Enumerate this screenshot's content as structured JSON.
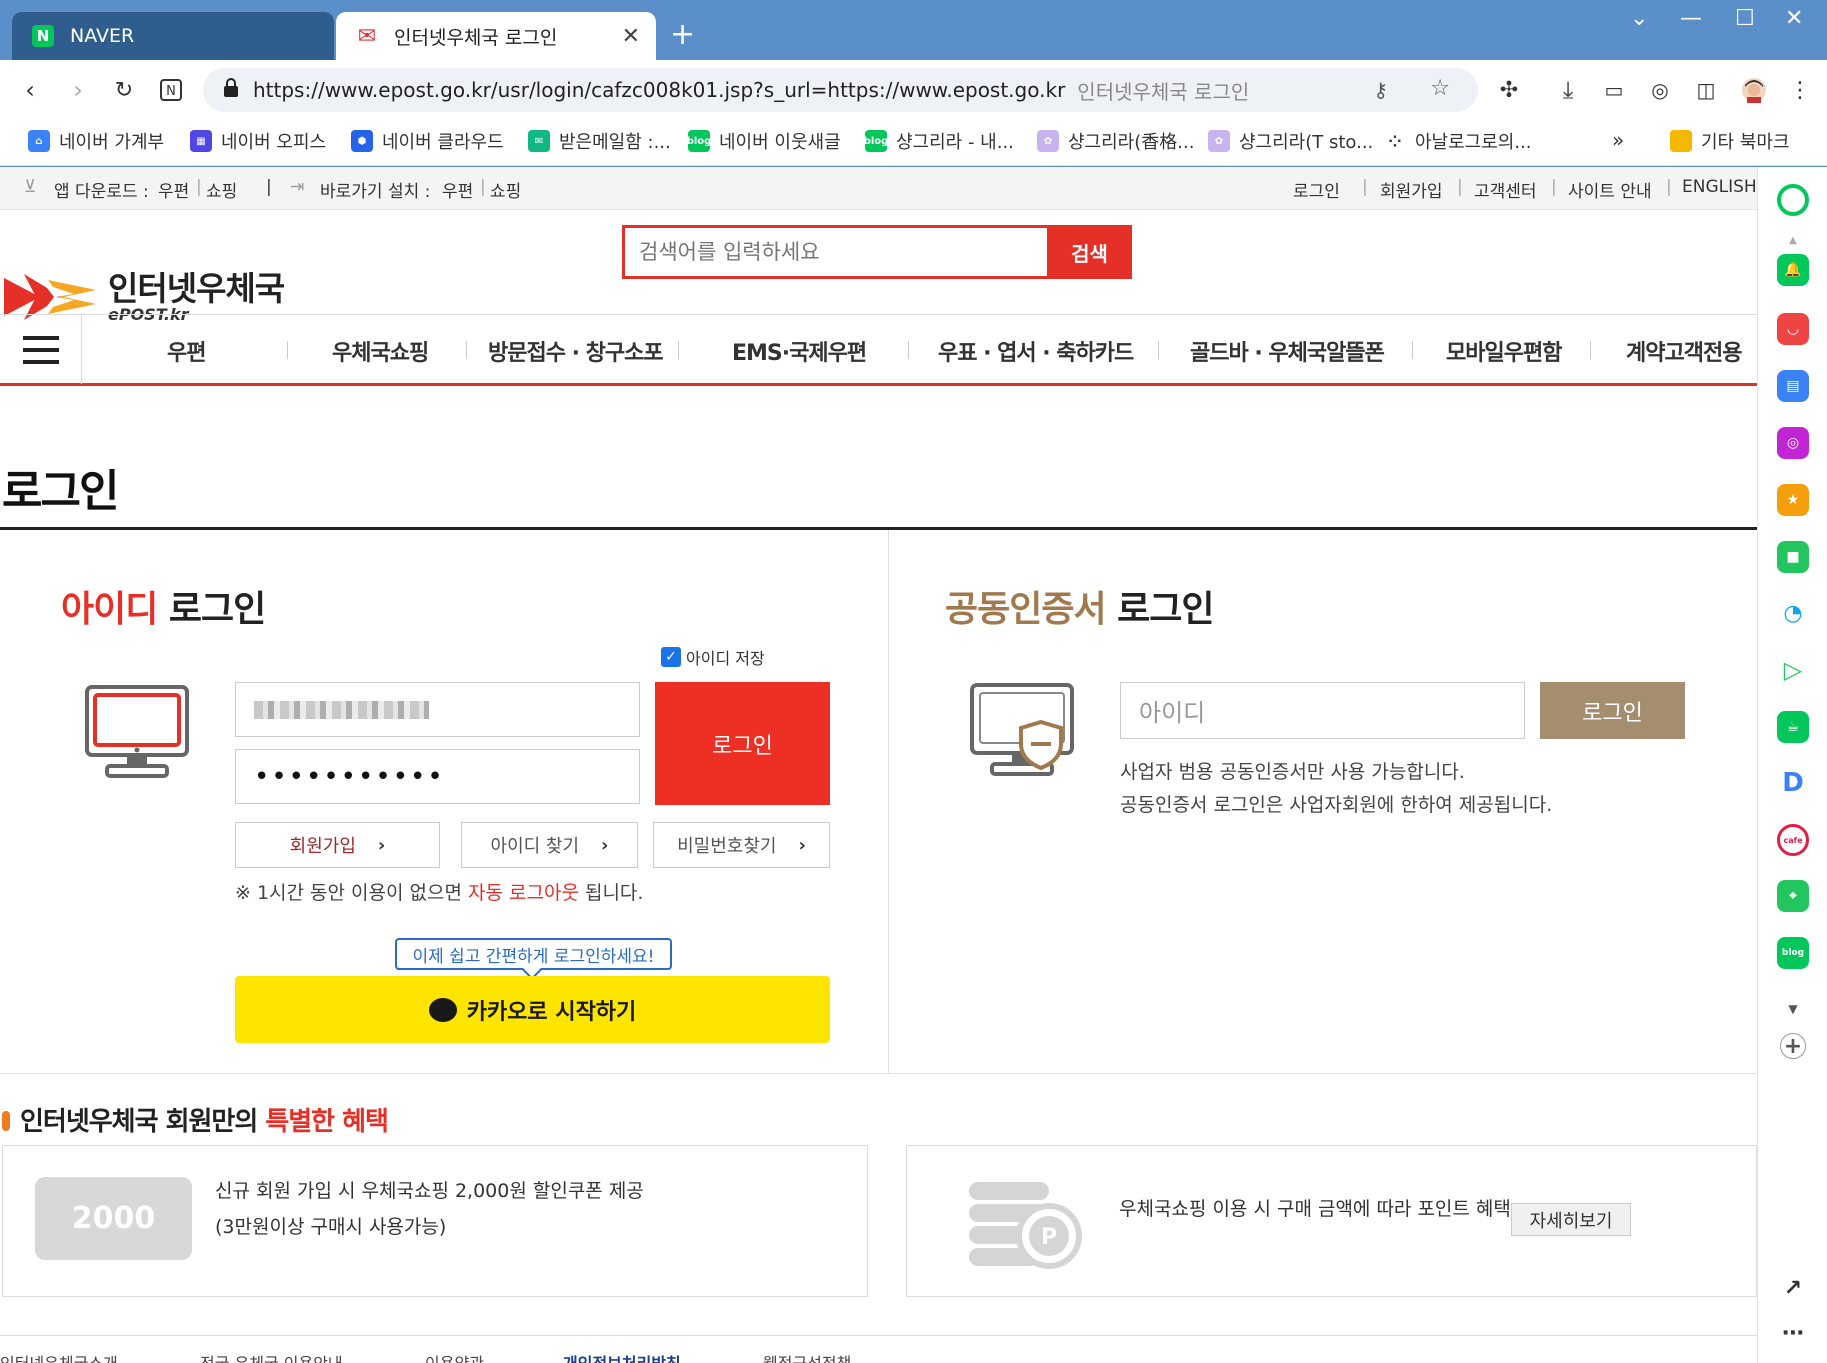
{
  "browser": {
    "tabs": [
      {
        "label": "NAVER",
        "icon": "naver-n-icon"
      },
      {
        "label": "인터넷우체국 로그인",
        "icon": "epost-logo-icon"
      }
    ],
    "url": "https://www.epost.go.kr/usr/login/cafzc008k01.jsp?s_url=https://www.epost.go.kr",
    "page_title_hint": "인터넷우체국 로그인",
    "bookmarks": [
      {
        "label": "네이버 가계부",
        "color": "#3b82f6"
      },
      {
        "label": "네이버 오피스",
        "color": "#4f46e5"
      },
      {
        "label": "네이버 클라우드",
        "color": "#2563eb"
      },
      {
        "label": "받은메일함 :...",
        "color": "#10b981"
      },
      {
        "label": "네이버 이웃새글",
        "color": "#03c75a"
      },
      {
        "label": "샹그리라 - 내...",
        "color": "#03c75a"
      },
      {
        "label": "샹그리라(香格...",
        "color": "#b59ae0"
      },
      {
        "label": "샹그리라(T sto...",
        "color": "#b59ae0"
      },
      {
        "label": "아날로그로의...",
        "color": "#333333"
      }
    ],
    "other_bookmarks": "기타 북마크"
  },
  "util": {
    "app_download_label": "앱 다운로드 :",
    "app_postal": "우편",
    "app_shopping": "쇼핑",
    "shortcut_label": "바로가기 설치 :",
    "shortcut_postal": "우편",
    "shortcut_shopping": "쇼핑",
    "links": [
      "로그인",
      "회원가입",
      "고객센터",
      "사이트 안내",
      "ENGLISH"
    ]
  },
  "header": {
    "logo_kr": "인터넷우체국",
    "logo_en": "ePOST.kr",
    "search_placeholder": "검색어를 입력하세요",
    "search_button": "검색"
  },
  "gnb": [
    "우편",
    "우체국쇼핑",
    "방문접수 · 창구소포",
    "EMS·국제우편",
    "우표 · 엽서 · 축하카드",
    "골드바 · 우체국알뜰폰",
    "모바일우편함",
    "계약고객전용"
  ],
  "page_title": "로그인",
  "id_login": {
    "title_accent": "아이디",
    "title_rest": "로그인",
    "save_id": "아이디 저장",
    "password_mask": "•••••••••••",
    "login_button": "로그인",
    "signup": "회원가입",
    "find_id": "아이디 찾기",
    "find_pw": "비밀번호찾기",
    "notice_pre": "※ 1시간 동안 이용이 없으면 ",
    "notice_red": "자동 로그아웃",
    "notice_post": " 됩니다.",
    "kakao_bubble": "이제 쉽고 간편하게 로그인하세요!",
    "kakao_button": "카카오로 시작하기"
  },
  "cert_login": {
    "title_accent": "공동인증서",
    "title_rest": "로그인",
    "id_placeholder": "아이디",
    "login_button": "로그인",
    "note1": "사업자 범용 공동인증서만 사용 가능합니다.",
    "note2": "공동인증서 로그인은 사업자회원에 한하여 제공됩니다."
  },
  "benefits": {
    "title_pre": "인터넷우체국 회원만의 ",
    "title_accent": "특별한 혜택",
    "coupon_value": "2000",
    "card1_line1": "신규 회원 가입 시 우체국쇼핑 2,000원 할인쿠폰 제공",
    "card1_line2": "(3만원이상 구매시 사용가능)",
    "card2_text": "우체국쇼핑 이용 시 구매 금액에 따라 포인트 혜택",
    "card2_button": "자세히보기"
  },
  "footer": [
    "인터넷우체국소개",
    "전국 우체국 이용안내",
    "이용약관",
    "개인정보처리방침",
    "웹접근성정책"
  ]
}
